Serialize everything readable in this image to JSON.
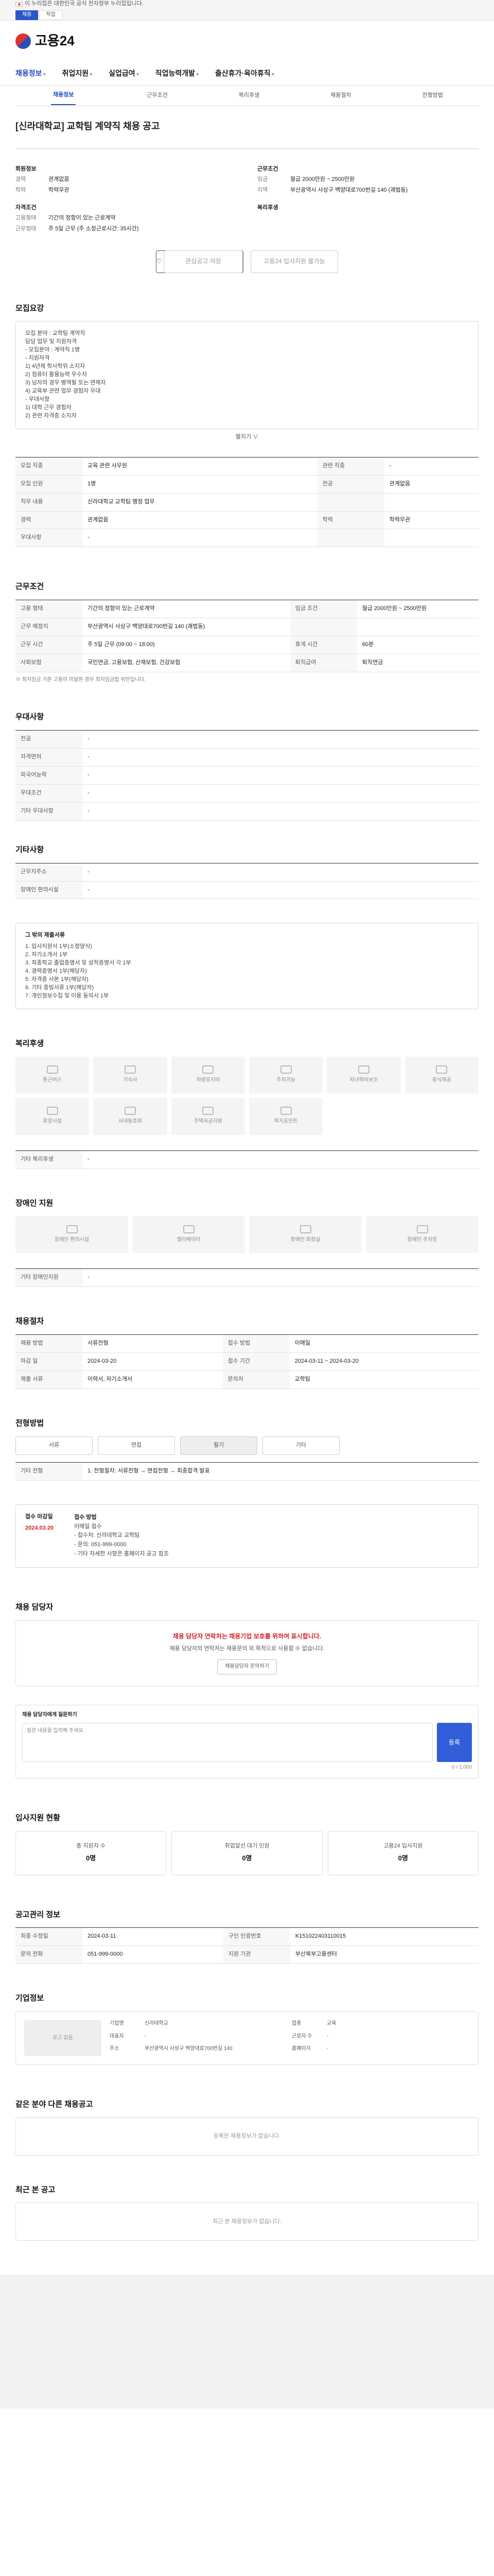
{
  "gov": {
    "text": "이 누리집은 대한민국 공식 전자정부 누리집입니다.",
    "tabs": [
      "채용",
      "직업"
    ]
  },
  "header": {
    "logo": "고용24",
    "nav": [
      "채용정보",
      "취업지원",
      "실업급여",
      "직업능력개발",
      "출산휴가·육아휴직"
    ],
    "subtabs": [
      "채용정보",
      "근무조건",
      "복리후생",
      "채용절차",
      "전형방법"
    ]
  },
  "job": {
    "title": "[신라대학교] 교학팀 계약직 채용 공고",
    "labels": {
      "company": "회원정보",
      "requirements": "자격조건",
      "conditions": "근무조건",
      "welfare": "복리후생"
    },
    "left": [
      {
        "k": "경력",
        "v": "관계없음"
      },
      {
        "k": "학력",
        "v": "학력무관"
      }
    ],
    "right": [
      {
        "k": "임금",
        "v": "월급 2000만원 ~ 2500만원"
      },
      {
        "k": "지역",
        "v": "부산광역시 사상구 백양대로700번길 140 (괘법동)"
      }
    ],
    "reqs": [
      {
        "k": "고용형태",
        "v": "기간의 정함이 있는 근로계약"
      },
      {
        "k": "근무형태",
        "v": "주 5일 근무 (주 소정근로시간: 35시간)"
      }
    ]
  },
  "buttons": {
    "scrap": "관심공고 저장",
    "apply": "고용24 입사지원 불가능"
  },
  "recruit": {
    "h": "모집요강",
    "lines": [
      "모집 분야 : 교학팀 계약직",
      "담당 업무 및 지원자격",
      "- 모집분야 : 계약직 1명",
      "- 지원자격",
      "1) 4년제 학사학위 소지자",
      "2) 컴퓨터 활용능력 우수자",
      "3) 남자의 경우 병역필 또는 면제자",
      "4) 교육부 관련 업무 경험자 우대",
      "- 우대사항",
      "1) 대학 근무 경험자",
      "2) 관련 자격증 소지자"
    ],
    "more": "펼치기 ∨"
  },
  "rows1": [
    [
      "모집 직종",
      "교육 관련 사무원",
      "관련 직종",
      "-"
    ],
    [
      "모집 인원",
      "1명",
      "전공",
      "관계없음"
    ],
    [
      "직무 내용",
      "신라대학교 교학팀 행정 업무",
      "",
      ""
    ],
    [
      "경력",
      "관계없음",
      "학력",
      "학력무관"
    ],
    [
      "우대사항",
      "-",
      "",
      ""
    ]
  ],
  "cond": {
    "h": "근무조건",
    "rows": [
      [
        "고용 형태",
        "기간의 정함이 있는 근로계약",
        "임금 조건",
        "월급 2000만원 ~ 2500만원"
      ],
      [
        "근무 예정지",
        "부산광역시 사상구 백양대로700번길 140 (괘법동)",
        "",
        ""
      ],
      [
        "근무 시간",
        "주 5일 근무 (09:00 ~ 18:00)",
        "휴게 시간",
        "60분"
      ],
      [
        "사회보험",
        "국민연금, 고용보험, 산재보험, 건강보험",
        "퇴직급여",
        "퇴직연금"
      ]
    ],
    "note": "※ 최저임금 기준 고용이 미달된 경우 최저임금법 위반입니다."
  },
  "extra": {
    "h": "우대사항",
    "rows": [
      [
        "전공",
        "-"
      ],
      [
        "자격면허",
        "-"
      ],
      [
        "외국어능력",
        "-"
      ],
      [
        "우대조건",
        "-"
      ],
      [
        "기타 우대사항",
        "-"
      ]
    ]
  },
  "service": {
    "h": "기타사항",
    "rows": [
      [
        "근무지주소",
        "-"
      ],
      [
        "장애인 편의시설",
        "-"
      ]
    ]
  },
  "noticebox": {
    "h": "그 밖의 제출서류",
    "lines": [
      "1. 입사지원서 1부(소정양식)",
      "2. 자기소개서 1부",
      "3. 최종학교 졸업증명서 및 성적증명서 각 1부",
      "4. 경력증명서 1부(해당자)",
      "5. 자격증 사본 1부(해당자)",
      "6. 기타 증빙서류 1부(해당자)",
      "7. 개인정보수집 및 이용 동의서 1부"
    ]
  },
  "welfare": {
    "h": "복리후생",
    "items": [
      "통근버스",
      "기숙사",
      "차량유지비",
      "주차가능",
      "자녀학비보조",
      "중식제공",
      "휴양시설",
      "사내동호회",
      "주택자금지원",
      "복지포인트",
      "",
      ""
    ],
    "sub": "기타 복리후생",
    "subv": "-"
  },
  "disability": {
    "h": "장애인 지원",
    "items": [
      "장애인 편의시설",
      "엘리베이터",
      "장애인 화장실",
      "장애인 주차장"
    ],
    "sub": "기타 장애인지원",
    "subv": "-"
  },
  "apply": {
    "h": "채용절차",
    "rows": [
      [
        "채용 방법",
        "서류전형",
        "접수 방법",
        "이메일"
      ],
      [
        "마감 일",
        "2024-03-20",
        "접수 기간",
        "2024-03-11 ~ 2024-03-20"
      ],
      [
        "제출 서류",
        "이력서, 자기소개서",
        "문의처",
        "교학팀"
      ]
    ]
  },
  "method": {
    "h": "전형방법",
    "tabs": [
      "서류",
      "면접",
      "필기",
      "기타"
    ],
    "sub": "기타 전형",
    "subv": "1. 전형절차: 서류전형 → 면접전형 → 최종합격 발표"
  },
  "schedule": {
    "h": "접수 마감일",
    "date": "2024.03.20",
    "dlabel": "접수 방법",
    "lines": [
      "이메일 접수",
      "- 접수처: 신라대학교 교학팀",
      "- 문의: 051-999-0000",
      "- 기타 자세한 사항은 홈페이지 공고 참조"
    ]
  },
  "contact": {
    "h": "채용 담당자",
    "warn": "채용 담당자 연락처는 채용기업 보호를 위하여 표시합니다.",
    "sub": "채용 담당자의 연락처는 채용문의 외 목적으로 사용할 수 없습니다.",
    "btn": "채용담당자 문의하기"
  },
  "qa": {
    "h": "채용 담당자에게 질문하기",
    "placeholder": "질문 내용을 입력해 주세요.",
    "count": "0 / 1,000",
    "btn": "등록"
  },
  "stats": {
    "h": "입사지원 현황",
    "items": [
      {
        "t": "총 지원자 수",
        "v": "0명"
      },
      {
        "t": "취업알선 대기 인원",
        "v": "0명"
      },
      {
        "t": "고용24 입사지원",
        "v": "0명"
      }
    ]
  },
  "meta": {
    "h": "공고관리 정보",
    "rows": [
      [
        "최종 수정일",
        "2024-03-11",
        "구인 인증번호",
        "K151022403110015"
      ],
      [
        "문의 전화",
        "051-999-0000",
        "지원 기관",
        "부산북부고용센터"
      ]
    ]
  },
  "company": {
    "h": "기업정보",
    "img": "로고 없음",
    "kv": [
      [
        "기업명",
        "신라대학교",
        "업종",
        "교육"
      ],
      [
        "대표자",
        "-",
        "근로자 수",
        "-"
      ],
      [
        "주소",
        "부산광역시 사상구 백양대로700번길 140",
        "홈페이지",
        "-"
      ]
    ]
  },
  "similar": {
    "h": "같은 분야 다른 채용공고",
    "empty": "등록된 채용정보가 없습니다."
  },
  "recent": {
    "h": "최근 본 공고",
    "empty": "최근 본 채용정보가 없습니다."
  }
}
